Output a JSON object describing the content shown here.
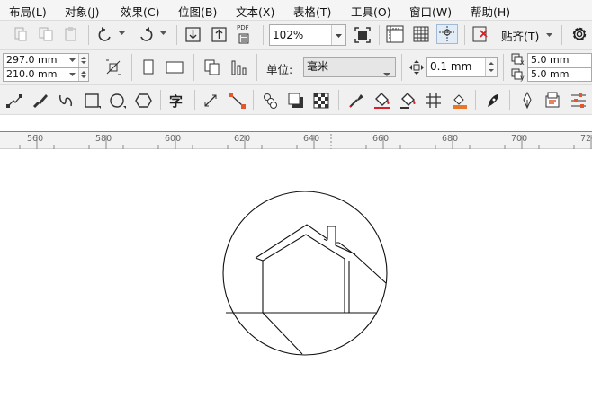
{
  "menu": [
    "布局(L)",
    "对象(J)",
    "效果(C)",
    "位图(B)",
    "文本(X)",
    "表格(T)",
    "工具(O)",
    "窗口(W)",
    "帮助(H)"
  ],
  "toolbar": {
    "zoom_value": "102%",
    "pdf_label": "PDF",
    "snap_label": "贴齐(T)"
  },
  "propbar": {
    "width_value": "297.0 mm",
    "height_value": "210.0 mm",
    "units_label": "单位:",
    "units_value": "毫米",
    "nudge_value": "0.1 mm",
    "dup_x_label": "x",
    "dup_y_label": "y",
    "dup_x_value": "5.0 mm",
    "dup_y_value": "5.0 mm"
  },
  "toolbox": {
    "text_tool_glyph": "字"
  },
  "ruler": {
    "labels": [
      "560",
      "580",
      "600",
      "620",
      "640",
      "660",
      "680",
      "700",
      "720"
    ]
  },
  "colors": {
    "ruler_accent": "#24a5c3",
    "ui_bg": "#f0f0f0",
    "canvas_bg": "#ffffff"
  }
}
